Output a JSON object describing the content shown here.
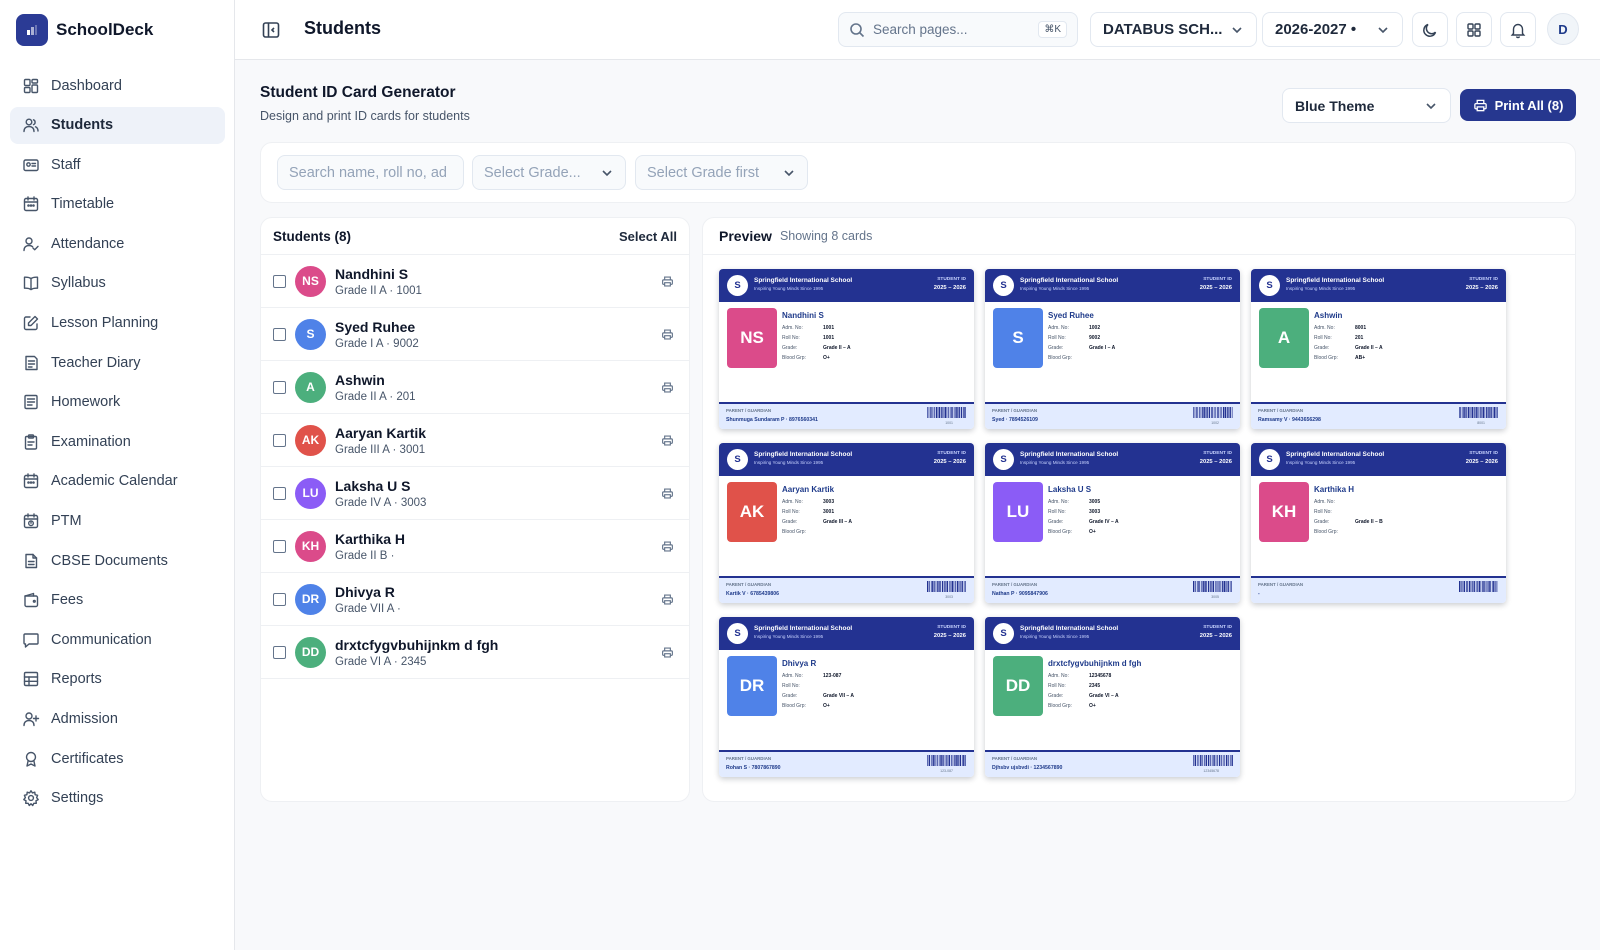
{
  "app": {
    "name": "SchoolDeck"
  },
  "topbar": {
    "title": "Students",
    "search_placeholder": "Search pages...",
    "search_shortcut": "⌘K",
    "school_select": "DATABUS SCH...",
    "year_select": "2026-2027 •",
    "avatar_letter": "D"
  },
  "sidebar": {
    "items": [
      {
        "label": "Dashboard",
        "icon": "dashboard-icon"
      },
      {
        "label": "Students",
        "icon": "students-icon",
        "active": true
      },
      {
        "label": "Staff",
        "icon": "staff-icon"
      },
      {
        "label": "Timetable",
        "icon": "calendar-icon"
      },
      {
        "label": "Attendance",
        "icon": "attendance-icon"
      },
      {
        "label": "Syllabus",
        "icon": "book-icon"
      },
      {
        "label": "Lesson Planning",
        "icon": "edit-icon"
      },
      {
        "label": "Teacher Diary",
        "icon": "diary-icon"
      },
      {
        "label": "Homework",
        "icon": "homework-icon"
      },
      {
        "label": "Examination",
        "icon": "clipboard-icon"
      },
      {
        "label": "Academic Calendar",
        "icon": "calendar-icon"
      },
      {
        "label": "PTM",
        "icon": "meeting-icon"
      },
      {
        "label": "CBSE Documents",
        "icon": "document-icon"
      },
      {
        "label": "Fees",
        "icon": "wallet-icon"
      },
      {
        "label": "Communication",
        "icon": "message-icon"
      },
      {
        "label": "Reports",
        "icon": "table-icon"
      },
      {
        "label": "Admission",
        "icon": "user-plus-icon"
      },
      {
        "label": "Certificates",
        "icon": "award-icon"
      },
      {
        "label": "Settings",
        "icon": "gear-icon"
      }
    ]
  },
  "page": {
    "title": "Student ID Card Generator",
    "subtitle": "Design and print ID cards for students",
    "theme_select": "Blue Theme",
    "print_all_label": "Print All (8)"
  },
  "filters": {
    "search_placeholder": "Search name, roll no, ad",
    "grade_placeholder": "Select Grade...",
    "section_placeholder": "Select Grade first"
  },
  "list": {
    "title": "Students (8)",
    "select_all": "Select All",
    "students": [
      {
        "initials": "NS",
        "name": "Nandhini S",
        "sub": "Grade II A · 1001",
        "color": "#db4b8a"
      },
      {
        "initials": "S",
        "name": "Syed Ruhee",
        "sub": "Grade I A · 9002",
        "color": "#4f82e8"
      },
      {
        "initials": "A",
        "name": "Ashwin",
        "sub": "Grade II A · 201",
        "color": "#4caf7d"
      },
      {
        "initials": "AK",
        "name": "Aaryan Kartik",
        "sub": "Grade III A · 3001",
        "color": "#e0524a"
      },
      {
        "initials": "LU",
        "name": "Laksha U S",
        "sub": "Grade IV A · 3003",
        "color": "#8b5cf6"
      },
      {
        "initials": "KH",
        "name": "Karthika H",
        "sub": "Grade II B ·",
        "color": "#db4b8a"
      },
      {
        "initials": "DR",
        "name": "Dhivya R",
        "sub": "Grade VII A ·",
        "color": "#4f82e8"
      },
      {
        "initials": "DD",
        "name": "drxtcfygvbuhijnkm d fgh",
        "sub": "Grade VI A · 2345",
        "color": "#4caf7d"
      }
    ]
  },
  "preview": {
    "title": "Preview",
    "count": "Showing 8 cards",
    "school_logo": "S",
    "school_name": "Springfield International School",
    "tagline": "Inspiring Young Minds Since 1995",
    "card_label": "STUDENT ID",
    "card_year": "2025 – 2026",
    "field_labels": {
      "adm": "Adm. No:",
      "roll": "Roll No:",
      "grade": "Grade:",
      "blood": "Blood Grp:"
    },
    "guardian_label": "PARENT / GUARDIAN",
    "cards": [
      {
        "initials": "NS",
        "name": "Nandhini S",
        "adm": "1001",
        "roll": "1001",
        "grade": "Grade II – A",
        "blood": "O+",
        "guardian": "Shunmuga Sundaram P · 8976560341",
        "barcode": "1001",
        "color": "#db4b8a"
      },
      {
        "initials": "S",
        "name": "Syed Ruhee",
        "adm": "1002",
        "roll": "9002",
        "grade": "Grade I – A",
        "blood": "",
        "guardian": "Syed · 7894526109",
        "barcode": "1002",
        "color": "#4f82e8"
      },
      {
        "initials": "A",
        "name": "Ashwin",
        "adm": "8001",
        "roll": "201",
        "grade": "Grade II – A",
        "blood": "AB+",
        "guardian": "Ramsamy V · 9443656298",
        "barcode": "8001",
        "color": "#4caf7d"
      },
      {
        "initials": "AK",
        "name": "Aaryan Kartik",
        "adm": "3003",
        "roll": "3001",
        "grade": "Grade III – A",
        "blood": "",
        "guardian": "Kartik V · 6785439806",
        "barcode": "3003",
        "color": "#e0524a"
      },
      {
        "initials": "LU",
        "name": "Laksha U S",
        "adm": "3005",
        "roll": "3003",
        "grade": "Grade IV – A",
        "blood": "O+",
        "guardian": "Nathan P · 9095847906",
        "barcode": "3005",
        "color": "#8b5cf6"
      },
      {
        "initials": "KH",
        "name": "Karthika H",
        "adm": "",
        "roll": "",
        "grade": "Grade II – B",
        "blood": "",
        "guardian": "-",
        "barcode": "",
        "color": "#db4b8a"
      },
      {
        "initials": "DR",
        "name": "Dhivya R",
        "adm": "123-087",
        "roll": "",
        "grade": "Grade VII – A",
        "blood": "O+",
        "guardian": "Rohan S · 7807867890",
        "barcode": "123-087",
        "color": "#4f82e8"
      },
      {
        "initials": "DD",
        "name": "drxtcfygvbuhijnkm d fgh",
        "adm": "12345678",
        "roll": "2345",
        "grade": "Grade VI – A",
        "blood": "O+",
        "guardian": "Djhsbv ujsbvdi · 1234567890",
        "barcode": "12345678",
        "color": "#4caf7d"
      }
    ]
  }
}
